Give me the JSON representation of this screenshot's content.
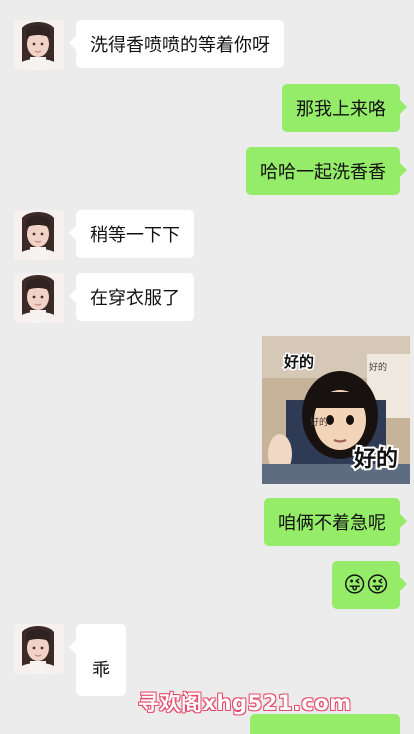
{
  "messages": [
    {
      "text": "洗得香喷喷的等着你呀"
    },
    {
      "text": "那我上来咯"
    },
    {
      "text": "哈哈一起洗香香"
    },
    {
      "text": "稍等一下下"
    },
    {
      "text": "在穿衣服了"
    },
    {
      "text": "好的"
    },
    {
      "text": "咱俩不着急呢"
    },
    {
      "text": "😜😜"
    },
    {
      "text": "乖"
    }
  ],
  "sticker": {
    "caption": "好的",
    "top_label": "好的",
    "small_label_1": "好的",
    "small_label_2": "好的"
  },
  "watermark": "寻欢阁xhg521.com",
  "colors": {
    "background": "#ececec",
    "incoming_bubble": "#ffffff",
    "outgoing_bubble": "#95ec69",
    "watermark_outline": "#e54a67"
  }
}
